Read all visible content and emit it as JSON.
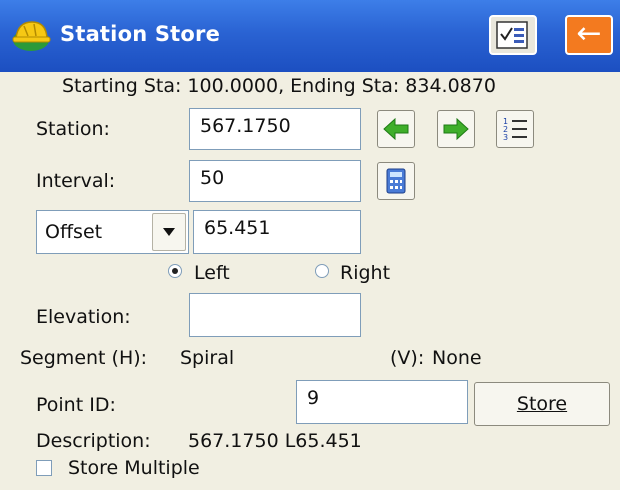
{
  "window": {
    "title": "Station Store"
  },
  "header": {
    "range_text": "Starting Sta: 100.0000, Ending Sta: 834.0870"
  },
  "station": {
    "label": "Station:",
    "value": "567.1750"
  },
  "interval": {
    "label": "Interval:",
    "value": "50"
  },
  "offset": {
    "type_selected": "Offset",
    "value": "65.451"
  },
  "side": {
    "left_label": "Left",
    "right_label": "Right",
    "selected": "Left"
  },
  "elevation": {
    "label": "Elevation:",
    "value": ""
  },
  "segment": {
    "h_label": "Segment (H):",
    "h_value": "Spiral",
    "v_label": "(V):",
    "v_value": "None"
  },
  "point": {
    "label": "Point ID:",
    "value": "9",
    "store_label": "Store"
  },
  "description": {
    "label": "Description:",
    "value": "567.1750 L65.451"
  },
  "store_multiple": {
    "label": "Store Multiple",
    "checked": false
  },
  "icons": {
    "app": "hard-hat-icon",
    "calc": "calculator-checklist-icon",
    "back": "back-arrow-icon",
    "prev": "left-arrow-icon",
    "next": "right-arrow-icon",
    "list": "numbered-list-icon",
    "interval_calc": "calculator-icon"
  },
  "colors": {
    "titlebar": "#2a63d3",
    "back_button": "#f37a1f",
    "arrow_green": "#3fae2a"
  }
}
